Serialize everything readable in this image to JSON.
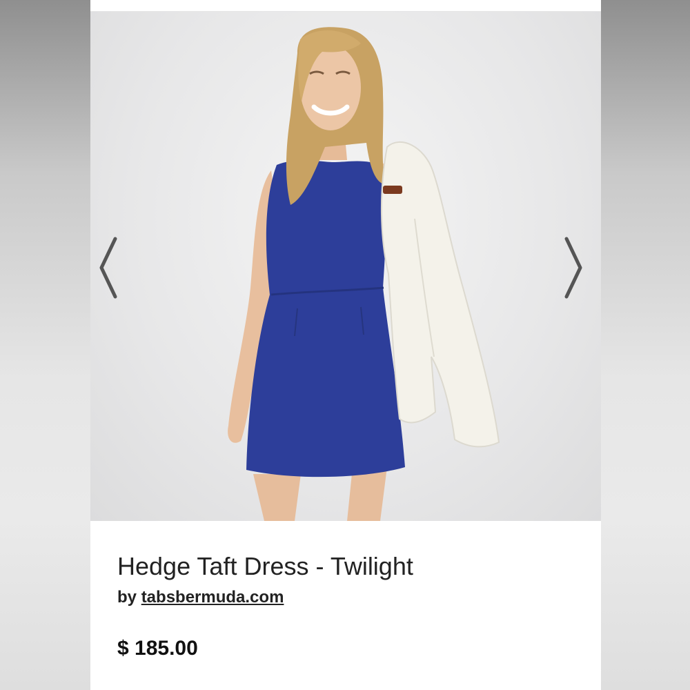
{
  "product": {
    "title": "Hedge Taft Dress - Twilight",
    "by_prefix": "by",
    "seller": "tabsbermuda.com",
    "price": "$ 185.00"
  },
  "gallery": {
    "prev_icon": "chevron-left-icon",
    "next_icon": "chevron-right-icon",
    "image_subject": "model-in-navy-sleeveless-dress-holding-white-blazer"
  },
  "colors": {
    "dress": "#2d3e9a",
    "blazer": "#f4f2ea",
    "hair": "#c8a263",
    "skin": "#e9c1a0",
    "arrow": "#555555"
  }
}
